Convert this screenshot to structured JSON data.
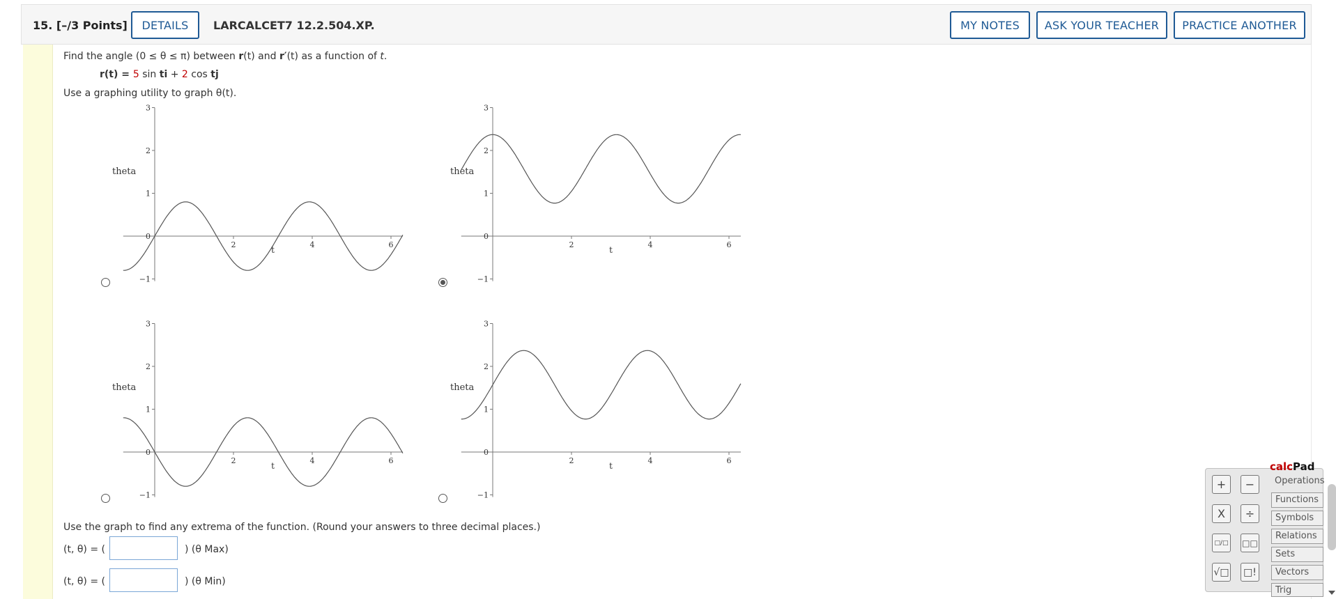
{
  "header": {
    "question_number": "15.",
    "points": "[–/3 Points]",
    "details_label": "DETAILS",
    "problem_code": "LARCALCET7 12.2.504.XP.",
    "my_notes_label": "MY NOTES",
    "ask_teacher_label": "ASK YOUR TEACHER",
    "practice_another_label": "PRACTICE ANOTHER"
  },
  "question": {
    "intro_prefix": "Find the angle (0 ≤ θ ≤ π) between ",
    "r": "r",
    "t_paren": "(t)",
    "and": " and ",
    "r_prime": "r′",
    "intro_suffix": " as a function of ",
    "t": "t",
    "period": ".",
    "eq_lhs": "r(t) = ",
    "coef1": "5",
    "sin_part": " sin ",
    "ti": "ti",
    "plus": " + ",
    "coef2": "2",
    "cos_part": " cos ",
    "tj": "tj",
    "graph_instruction": "Use a graphing utility to graph θ(t).",
    "extrema_instruction": "Use the graph to find any extrema of the function. (Round your answers to three decimal places.)"
  },
  "graph_labels": {
    "ylabel": "theta",
    "xlabel": "t",
    "yticks": [
      "3",
      "2",
      "1",
      "0",
      "−1"
    ],
    "xticks": [
      "2",
      "4",
      "6"
    ]
  },
  "chart_data": [
    {
      "type": "line",
      "option": "top-left",
      "selected": false,
      "xlabel": "t",
      "ylabel": "theta",
      "xlim": [
        -0.8,
        6.3
      ],
      "ylim": [
        -1,
        3
      ],
      "formula": "0.8*sin(2*t)"
    },
    {
      "type": "line",
      "option": "top-right",
      "selected": true,
      "xlabel": "t",
      "ylabel": "theta",
      "xlim": [
        -0.8,
        6.3
      ],
      "ylim": [
        -1,
        3
      ],
      "formula": "1.57+0.8*cos(2*t)"
    },
    {
      "type": "line",
      "option": "bottom-left",
      "selected": false,
      "xlabel": "t",
      "ylabel": "theta",
      "xlim": [
        -0.8,
        6.3
      ],
      "ylim": [
        -1,
        3
      ],
      "formula": "-0.8*sin(2*t)"
    },
    {
      "type": "line",
      "option": "bottom-right",
      "selected": false,
      "xlabel": "t",
      "ylabel": "theta",
      "xlim": [
        -0.8,
        6.3
      ],
      "ylim": [
        -1,
        3
      ],
      "formula": "1.57+0.8*sin(2*t)"
    }
  ],
  "answers": {
    "row1_prefix": "(t, θ) = (",
    "row1_suffix": ") (θ Max)",
    "row1_value": "",
    "row2_prefix": "(t, θ) = (",
    "row2_suffix": ") (θ Min)",
    "row2_value": ""
  },
  "calcpad": {
    "title_calc": "calc",
    "title_pad": "Pad",
    "buttons": [
      "+",
      "−",
      "X",
      "÷",
      "□/□",
      "□□",
      "√□",
      "□!"
    ],
    "tabs": [
      "Operations",
      "Functions",
      "Symbols",
      "Relations",
      "Sets",
      "Vectors",
      "Trig"
    ]
  },
  "colors": {
    "accent": "#1f5a95",
    "highlight_red": "#c00000",
    "sidebar_yellow": "#fcfcdc"
  }
}
